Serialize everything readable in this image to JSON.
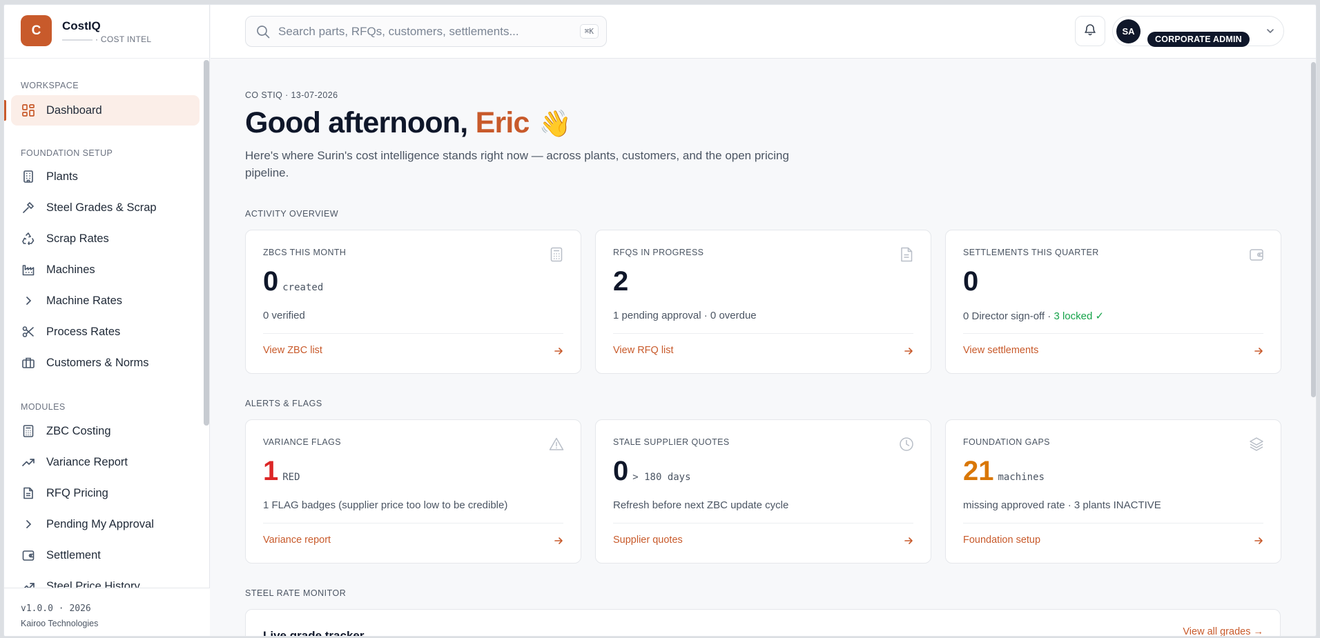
{
  "brand": {
    "initial": "C",
    "name": "CostIQ",
    "subtitle": "· COST INTEL"
  },
  "sidebar": {
    "sections": {
      "workspace": "WORKSPACE",
      "foundation": "FOUNDATION SETUP",
      "modules": "MODULES"
    },
    "workspace_items": [
      {
        "label": "Dashboard",
        "icon": "dashboard-grid-icon",
        "active": true
      }
    ],
    "foundation_items": [
      {
        "label": "Plants",
        "icon": "building-icon"
      },
      {
        "label": "Steel Grades & Scrap",
        "icon": "hammer-icon"
      },
      {
        "label": "Scrap Rates",
        "icon": "recycle-icon"
      },
      {
        "label": "Machines",
        "icon": "factory-icon"
      },
      {
        "label": "Machine Rates",
        "icon": "chevron-right-icon"
      },
      {
        "label": "Process Rates",
        "icon": "scissors-icon"
      },
      {
        "label": "Customers & Norms",
        "icon": "briefcase-icon"
      }
    ],
    "module_items": [
      {
        "label": "ZBC Costing",
        "icon": "calculator-icon"
      },
      {
        "label": "Variance Report",
        "icon": "trending-up-icon"
      },
      {
        "label": "RFQ Pricing",
        "icon": "document-icon"
      },
      {
        "label": "Pending My Approval",
        "icon": "chevron-right-icon"
      },
      {
        "label": "Settlement",
        "icon": "wallet-icon"
      },
      {
        "label": "Steel Price History",
        "icon": "trending-up-icon"
      }
    ],
    "footer": {
      "version": "v1.0.0 · 2026",
      "company": "Kairoo Technologies"
    }
  },
  "topbar": {
    "search_placeholder": "Search parts, RFQs, customers, settlements...",
    "search_shortcut": "⌘K",
    "user_initials": "SA",
    "user_role": "CORPORATE ADMIN"
  },
  "main": {
    "eyebrow": "CO STIQ · 13-07-2026",
    "greeting_prefix": "Good afternoon,",
    "greeting_name": "Eric",
    "greeting_emoji": "👋",
    "intro": "Here's where Surin's cost intelligence stands right now — across plants, customers, and the open pricing pipeline.",
    "activity_label": "ACTIVITY OVERVIEW",
    "alerts_label": "ALERTS & FLAGS",
    "steel_label": "STEEL RATE MONITOR",
    "activity_cards": [
      {
        "title": "ZBCS THIS MONTH",
        "value": "0",
        "unit": "created",
        "sub": "0 verified",
        "link": "View ZBC list",
        "icon": "calculator-icon"
      },
      {
        "title": "RFQS IN PROGRESS",
        "value": "2",
        "unit": "",
        "sub": "1 pending approval · 0 overdue",
        "link": "View RFQ list",
        "icon": "document-icon"
      },
      {
        "title": "SETTLEMENTS THIS QUARTER",
        "value": "0",
        "unit": "",
        "sub": "0 Director sign-off · ",
        "sub_ok": "3 locked ✓",
        "link": "View settlements",
        "icon": "wallet-icon"
      }
    ],
    "alert_cards": [
      {
        "title": "VARIANCE FLAGS",
        "value": "1",
        "unit": "RED",
        "sub": "1 FLAG badges (supplier price too low to be credible)",
        "link": "Variance report",
        "icon": "warning-triangle-icon"
      },
      {
        "title": "STALE SUPPLIER QUOTES",
        "value": "0",
        "unit": "> 180 days",
        "sub": "Refresh before next ZBC update cycle",
        "link": "Supplier quotes",
        "icon": "clock-icon"
      },
      {
        "title": "FOUNDATION GAPS",
        "value": "21",
        "unit": "machines",
        "sub": "missing approved rate · 3 plants INACTIVE",
        "link": "Foundation setup",
        "icon": "layers-icon"
      }
    ],
    "tracker": {
      "title": "Live grade tracker",
      "link": "View all grades →"
    }
  },
  "colors": {
    "accent": "#c85a2b",
    "danger": "#dc2626",
    "warning": "#d97706",
    "success": "#16a34a",
    "ink": "#0f172a"
  }
}
